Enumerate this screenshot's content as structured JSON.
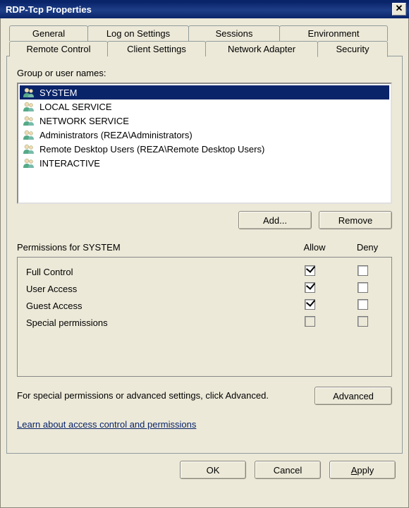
{
  "window": {
    "title": "RDP-Tcp Properties",
    "close_glyph": "✕"
  },
  "tabs": {
    "row1": [
      "General",
      "Log on Settings",
      "Sessions",
      "Environment"
    ],
    "row2": [
      "Remote Control",
      "Client Settings",
      "Network Adapter",
      "Security"
    ],
    "active": "Security"
  },
  "group_label": "Group or user names:",
  "users": [
    {
      "name": "SYSTEM",
      "selected": true
    },
    {
      "name": "LOCAL SERVICE",
      "selected": false
    },
    {
      "name": "NETWORK SERVICE",
      "selected": false
    },
    {
      "name": "Administrators (REZA\\Administrators)",
      "selected": false
    },
    {
      "name": "Remote Desktop Users (REZA\\Remote Desktop Users)",
      "selected": false
    },
    {
      "name": "INTERACTIVE",
      "selected": false
    }
  ],
  "buttons": {
    "add": "Add...",
    "remove": "Remove",
    "advanced": "Advanced",
    "ok": "OK",
    "cancel": "Cancel",
    "apply": "Apply"
  },
  "permissions_header": {
    "label": "Permissions for SYSTEM",
    "allow": "Allow",
    "deny": "Deny"
  },
  "permissions": [
    {
      "name": "Full Control",
      "allow": true,
      "deny": false,
      "greyed": false
    },
    {
      "name": "User Access",
      "allow": true,
      "deny": false,
      "greyed": false
    },
    {
      "name": "Guest Access",
      "allow": true,
      "deny": false,
      "greyed": false
    },
    {
      "name": "Special permissions",
      "allow": false,
      "deny": false,
      "greyed": true
    }
  ],
  "advanced_text": "For special permissions or advanced settings, click Advanced.",
  "help_link": "Learn about access control and permissions"
}
